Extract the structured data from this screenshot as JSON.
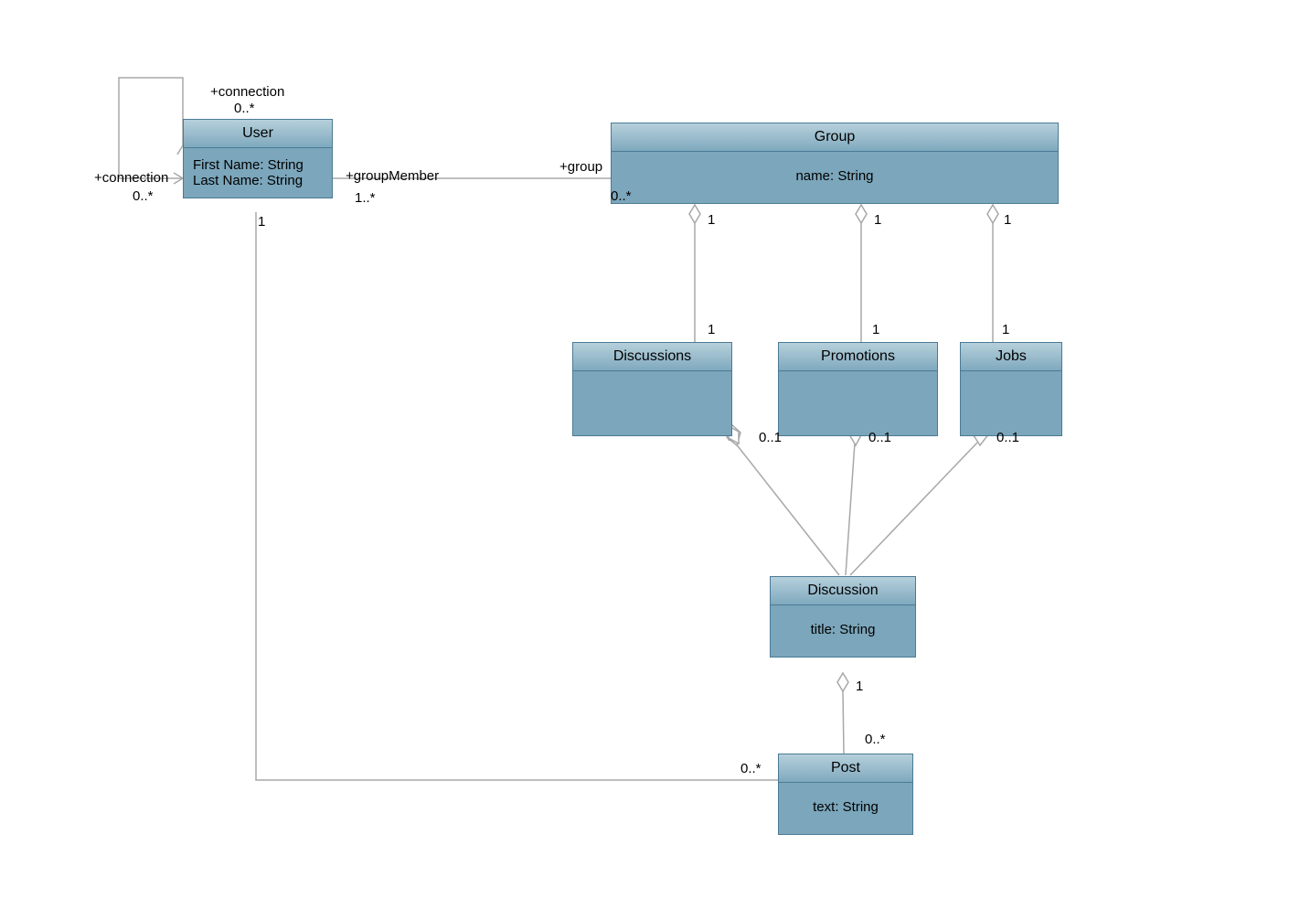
{
  "classes": {
    "user": {
      "name": "User",
      "attrs": [
        "First Name: String",
        "Last Name: String"
      ]
    },
    "group": {
      "name": "Group",
      "attrs": [
        "name: String"
      ]
    },
    "discussions": {
      "name": "Discussions",
      "attrs": []
    },
    "promotions": {
      "name": "Promotions",
      "attrs": []
    },
    "jobs": {
      "name": "Jobs",
      "attrs": []
    },
    "discussion": {
      "name": "Discussion",
      "attrs": [
        "title: String"
      ]
    },
    "post": {
      "name": "Post",
      "attrs": [
        "text: String"
      ]
    }
  },
  "labels": {
    "conn_top": "+connection",
    "conn_top_mult": "0..*",
    "conn_left": "+connection",
    "conn_left_mult": "0..*",
    "groupMember": "+groupMember",
    "groupMember_mult": "1..*",
    "groupRole": "+group",
    "groupRole_mult": "0..*",
    "user_one": "1",
    "group_one_a": "1",
    "group_one_b": "1",
    "group_one_c": "1",
    "disc_one": "1",
    "prom_one": "1",
    "jobs_one": "1",
    "disc_zo": "0..1",
    "prom_zo": "0..1",
    "jobs_zo": "0..1",
    "discussion_one": "1",
    "post_zm": "0..*",
    "post_left_zm": "0..*"
  }
}
